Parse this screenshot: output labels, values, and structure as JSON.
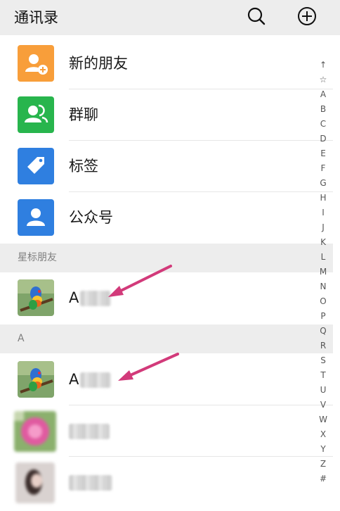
{
  "header": {
    "title": "通讯录",
    "search_icon": "search-icon",
    "add_icon": "add-circle-icon"
  },
  "functions": [
    {
      "label": "新的朋友",
      "icon": "new-friend-icon",
      "color": "#f89e3a"
    },
    {
      "label": "群聊",
      "icon": "group-chat-icon",
      "color": "#28b54d"
    },
    {
      "label": "标签",
      "icon": "tag-icon",
      "color": "#2f7fe0"
    },
    {
      "label": "公众号",
      "icon": "official-account-icon",
      "color": "#2f7fe0"
    }
  ],
  "sections": {
    "starred": "星标朋友",
    "a": "A"
  },
  "contacts": {
    "starred_contact_initial": "A",
    "a_contact_initial": "A"
  },
  "index_bar": [
    "↑",
    "☆",
    "A",
    "B",
    "C",
    "D",
    "E",
    "F",
    "G",
    "H",
    "I",
    "J",
    "K",
    "L",
    "M",
    "N",
    "O",
    "P",
    "Q",
    "R",
    "S",
    "T",
    "U",
    "V",
    "W",
    "X",
    "Y",
    "Z",
    "#"
  ]
}
